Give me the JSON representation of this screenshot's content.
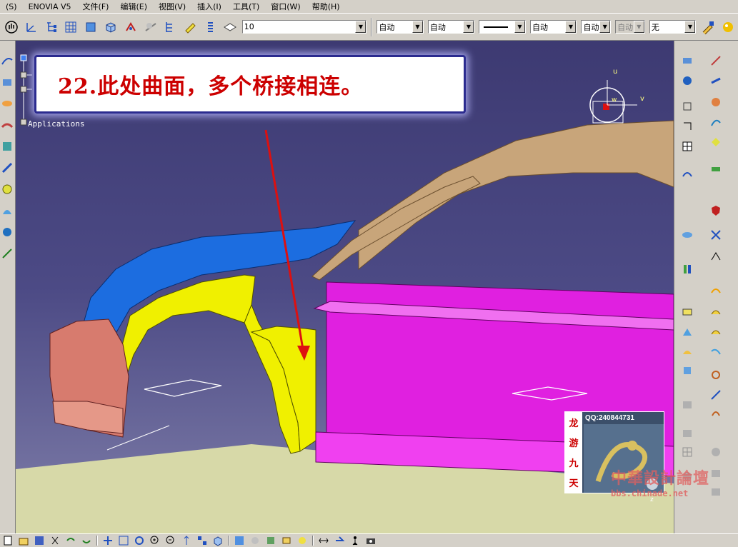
{
  "menubar": {
    "items": [
      {
        "label": "(S)"
      },
      {
        "label": "ENOVIA V5"
      },
      {
        "label": "文件(F)"
      },
      {
        "label": "编辑(E)"
      },
      {
        "label": "视图(V)"
      },
      {
        "label": "插入(I)"
      },
      {
        "label": "工具(T)"
      },
      {
        "label": "窗口(W)"
      },
      {
        "label": "帮助(H)"
      }
    ]
  },
  "toolbar": {
    "layer_value": "10",
    "color_value": "自动",
    "transparency_value": "自动",
    "linewidth_value": "自动",
    "linetype_value": "自动",
    "point_value": "自动",
    "layer_filter_value": "无"
  },
  "viewport": {
    "callout_text": "22.此处曲面，多个桥接相连。",
    "tree_label": "Applications",
    "compass_u": "u",
    "compass_v": "v",
    "compass_w": "w",
    "axis_z": "z"
  },
  "watermark": {
    "qq": "QQ:240844731",
    "side_chars": [
      "龙",
      "游",
      "九",
      "天"
    ],
    "site_name": "中華設計論壇",
    "site_url": "bbs.chinade.net"
  },
  "colors": {
    "viewport_top": "#3d3a72",
    "floor": "#d7d9a8",
    "fender_blue": "#1c6de0",
    "surface_yellow": "#f0f000",
    "door_magenta": "#e020e0",
    "bumper_salmon": "#d77b6e",
    "roof_tan": "#c8a57a",
    "callout_text": "#cc0000"
  }
}
